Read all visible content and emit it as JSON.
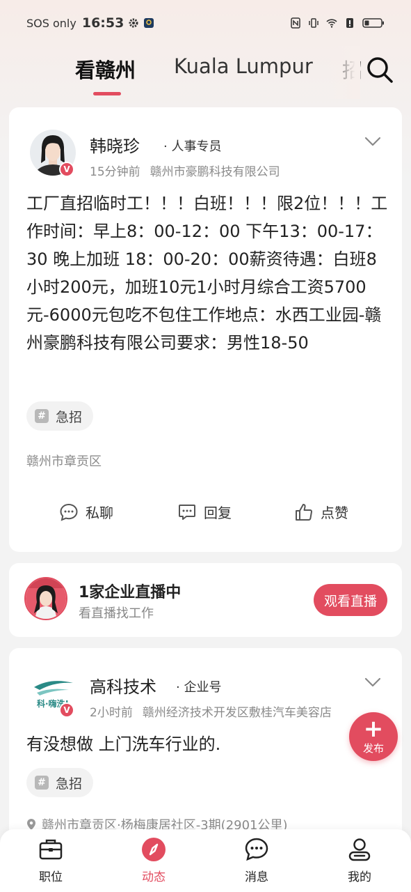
{
  "status_bar": {
    "carrier": "SOS only",
    "time": "16:53"
  },
  "top_tabs": {
    "items": [
      "看赣州",
      "Kuala Lumpur",
      "招"
    ],
    "active_index": 0
  },
  "posts": [
    {
      "author": "韩晓珍",
      "role": "· 人事专员",
      "time": "15分钟前",
      "company": "赣州市豪鹏科技有限公司",
      "body": "工厂直招临时工！！！白班！！！限2位！！！工作时间：早上8：00-12：00 下午13：00-17：30 晚上加班 18：00-20：00薪资待遇：白班8小时200元，加班10元1小时月综合工资5700元-6000元包吃不包住工作地点：水西工业园-赣州豪鹏科技有限公司要求：男性18-50",
      "tag": "急招",
      "location": "赣州市章贡区",
      "actions": [
        "私聊",
        "回复",
        "点赞"
      ]
    },
    {
      "author": "高科技术",
      "role": "· 企业号",
      "time": "2小时前",
      "company": "赣州经济技术开发区敷桂汽车美容店",
      "body": "有没想做 上门洗车行业的.",
      "tag": "急招",
      "location": "赣州市章贡区·杨梅康居社区-3期(2901公里)",
      "avatar_text": "科·嗨洗!"
    }
  ],
  "live_banner": {
    "title": "1家企业直播中",
    "subtitle": "看直播找工作",
    "button": "观看直播"
  },
  "fab": {
    "label": "发布"
  },
  "bottom_nav": {
    "items": [
      {
        "label": "职位",
        "icon": "briefcase-icon"
      },
      {
        "label": "动态",
        "icon": "compass-icon"
      },
      {
        "label": "消息",
        "icon": "chat-bubble-icon"
      },
      {
        "label": "我的",
        "icon": "person-icon"
      }
    ],
    "active_index": 1
  },
  "colors": {
    "accent": "#e24c5f",
    "text": "#222222",
    "muted": "#8a8a8a"
  }
}
